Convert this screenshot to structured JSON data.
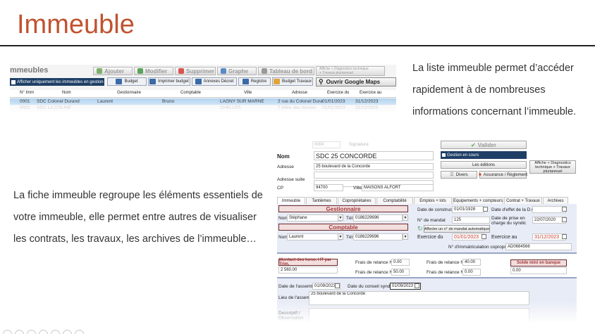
{
  "slide": {
    "title": "Immeuble",
    "para1": "La liste immeuble permet d’accéder rapidement à de nombreuses informations concernant l’immeuble.",
    "para2": "La fiche immeuble regroupe les éléments essentiels de votre immeuble, elle permet entre autres de visualiser les contrats, les travaux, les archives de l’immeuble…"
  },
  "list_screen": {
    "title": "mmeubles",
    "toolbar": {
      "add": "Ajouter",
      "modify": "Modifier",
      "delete": "Supprimer",
      "graph": "Graphe",
      "dashboard": "Tableau de bord",
      "diag": "Affiche + Diagnostics technique",
      "works": "+ Travaux pluriannuel"
    },
    "filter_label": "Afficher uniquement les immeubles en gestion",
    "actions": {
      "budget": "Budget",
      "print_budget": "Imprimer budget",
      "decree": "Annexes Décret",
      "register": "Registre",
      "works_budget": "Budget Travaux",
      "maps": "Ouvrir Google Maps"
    },
    "columns": [
      "N° Imm",
      "Nom",
      "Gestionnaire",
      "Comptable",
      "Ville",
      "Adresse",
      "Exercice du",
      "Exercice au"
    ],
    "rows": [
      [
        "0001",
        "SDC Colonel Durand",
        "Laurent",
        "Bruno",
        "LAGNY SUR MARNE",
        "2 rue du Colonel Dura",
        "01/01/2023",
        "31/12/2023"
      ],
      [
        "0002",
        "SDC LA COLINE",
        "",
        "",
        "CHELLES",
        "7 Allée des meules",
        "01/01/2023",
        "31/12/2023"
      ]
    ]
  },
  "form_screen": {
    "id_placeholder": "0004",
    "signature_label": "Signature",
    "validate": "Valider",
    "in_management": "Gestion en cours",
    "editions": "Les éditions",
    "diverse": "Divers",
    "insurance": "Assurance / Règlement",
    "diag": "Affiche + Diagnostics technique + Travaux pluriannuel",
    "name_label": "Nom",
    "name_value": "SDC 25 CONCORDE",
    "address_label": "Adresse",
    "address_value": "25 boulevard de la Concorde",
    "address_suite_label": "Adresse suite",
    "cp_label": "CP",
    "cp_value": "94700",
    "city_label": "Ville",
    "city_value": "MAISONS ALFORT",
    "tabs": [
      "Immeuble",
      "Tantièmes",
      "Copropriétaires",
      "Comptabilité",
      "Emplois + lots",
      "Equipements + compteurs",
      "Contrat + Travaux",
      "Archives"
    ],
    "gestionnaire_title": "Gestionnaire",
    "gest_name_label": "Nom",
    "gest_name": "Stéphane",
    "tel_label": "Tél",
    "gest_tel": "0186229696",
    "comptable_title": "Comptable",
    "compt_name": "Laurent",
    "compt_tel": "0186229696",
    "construction_label": "Date de construction",
    "construction_value": "01/01/1928",
    "do_label": "Date d'effet de la D.O",
    "mandate_label": "N° de mandat",
    "mandate_value": "125",
    "syndic_label": "Date de prise en charge du syndic",
    "syndic_value": "22/07/2020",
    "auto_mandate": "Affecter un n° de mandat automatique",
    "exercise_from_label": "Exercice du",
    "exercise_from": "01/01/2023",
    "exercise_to_label": "Exercice au",
    "exercise_to": "31/12/2023",
    "registration_label": "N° d'immatriculation copropriété",
    "registration_value": "AD0684566",
    "fees_title": "Montant des hono. HT par Trim.",
    "fees_value": "2 560.00",
    "relance1_label": "Frais de relance N° 1",
    "relance1_value": "0.00",
    "relance2_label": "Frais de relance N° 2",
    "relance2_value": "40.00",
    "relance3_label": "Frais de relance N° 3",
    "relance3_value": "50.00",
    "relance4_label": "Frais de relance N° 4",
    "relance4_value": "0.00",
    "bank_title": "Solde mini en banque",
    "bank_value": "0.00",
    "assembly_label": "Date de l'assemblée",
    "assembly_value": "01/09/2023",
    "council_label": "Date du conseil syndical",
    "council_value": "01/09/2023",
    "assembly_place_label": "Lieu de l'assemblée",
    "assembly_place_value": "25 boulevard de la Concorde",
    "description_label": "Descriptif / Observation"
  },
  "colors": {
    "title": "#c0532f",
    "navy": "#1f3f66",
    "selection": "#b5d4f0",
    "section_red": "#a23a3a"
  }
}
